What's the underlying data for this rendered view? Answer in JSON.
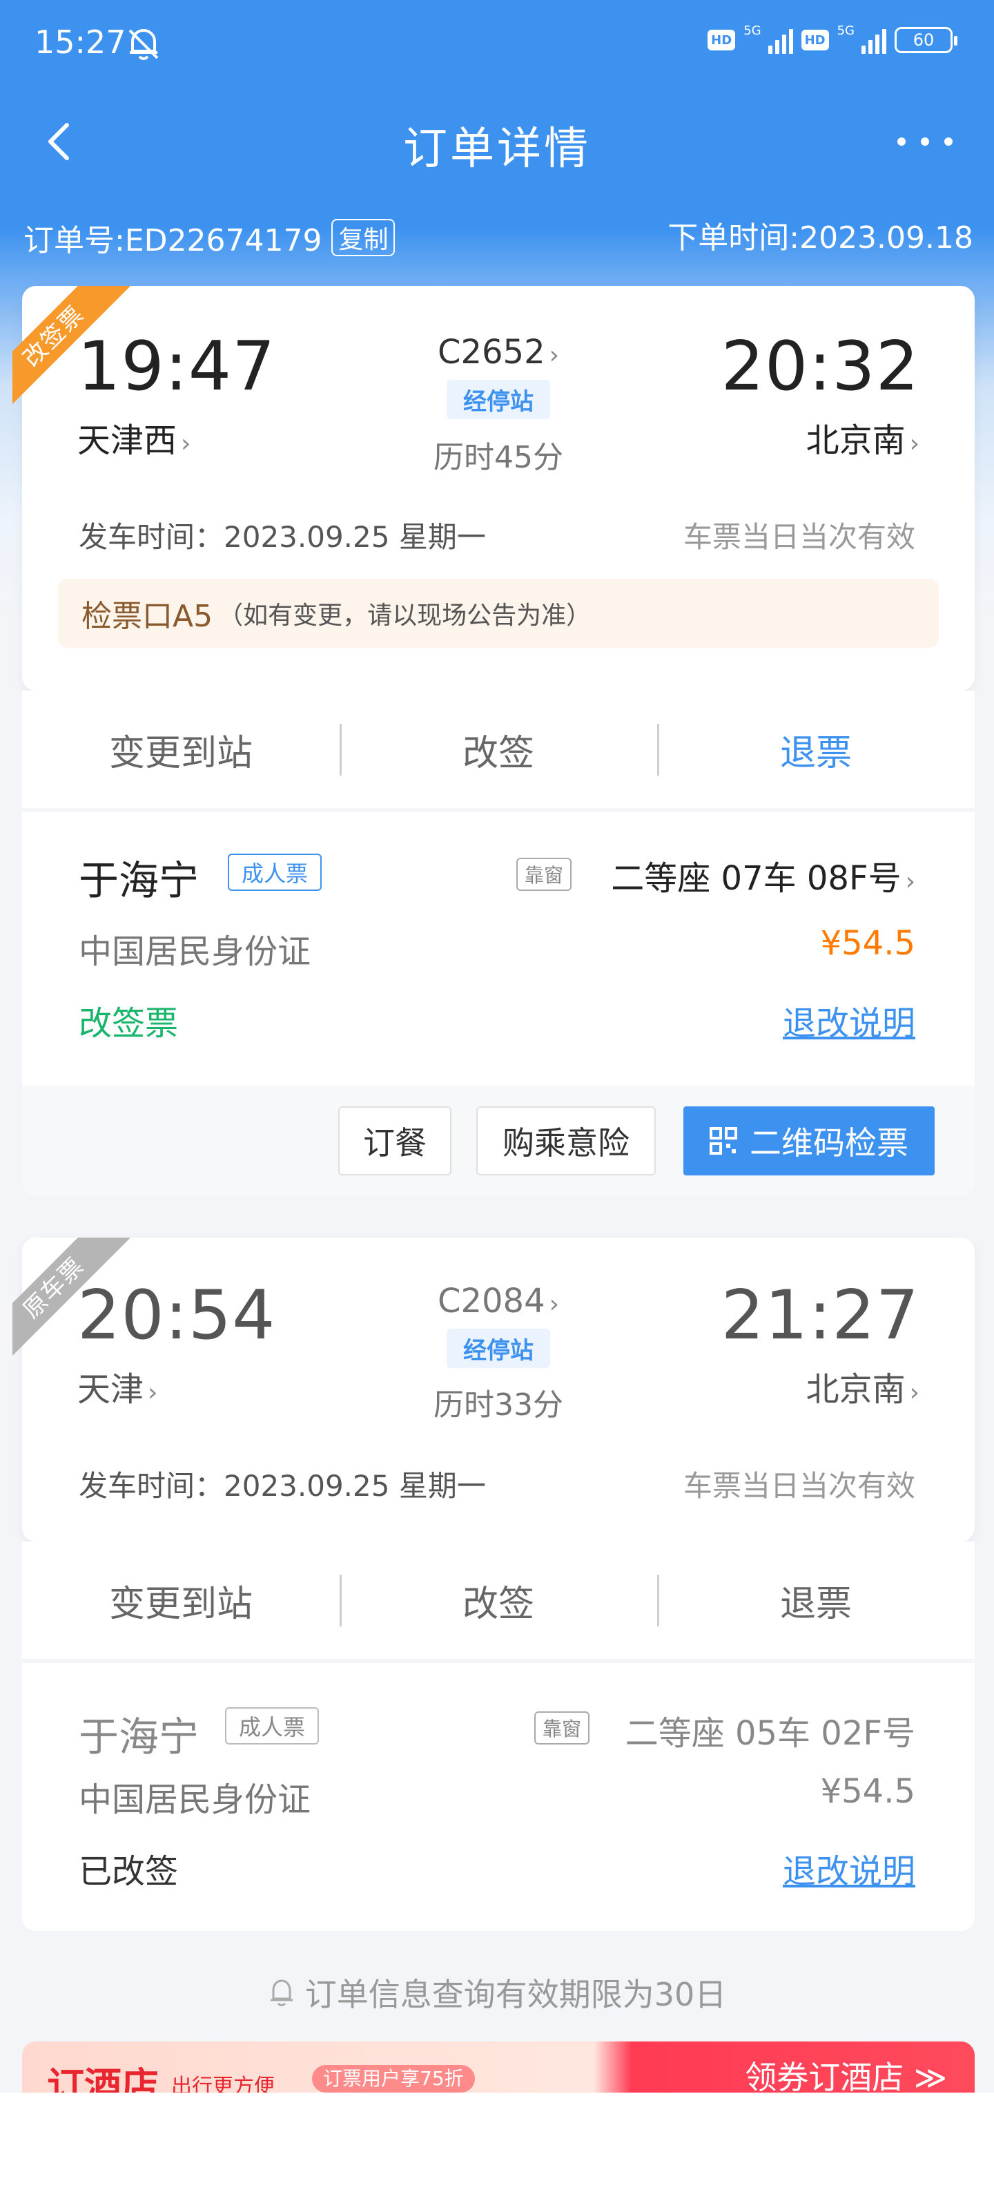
{
  "status_bar": {
    "time": "15:27",
    "network_1": "5G",
    "network_2": "5G",
    "battery": "60"
  },
  "header": {
    "title": "订单详情"
  },
  "order": {
    "number_label": "订单号:ED22674179",
    "copy_label": "复制",
    "time_label": "下单时间:2023.09.18"
  },
  "new_ticket": {
    "ribbon": "改签票",
    "depart_time": "19:47",
    "depart_station": "天津西",
    "train_no": "C2652",
    "via_label": "经停站",
    "duration": "历时45分",
    "arrive_time": "20:32",
    "arrive_station": "北京南",
    "depart_date": "发车时间：2023.09.25 星期一",
    "validity": "车票当日当次有效",
    "gate_main": "检票口A5",
    "gate_note": "（如有变更，请以现场公告为准）",
    "actions": [
      "变更到站",
      "改签",
      "退票"
    ],
    "passenger": {
      "name": "于海宁",
      "type": "成人票",
      "window_tag": "靠窗",
      "seat": "二等座 07车 08F号",
      "id_type": "中国居民身份证",
      "price": "¥54.5",
      "status": "改签票",
      "rules_link": "退改说明"
    },
    "buttons": {
      "meal": "订餐",
      "insurance": "购乘意险",
      "qr": "二维码检票"
    }
  },
  "old_ticket": {
    "ribbon": "原车票",
    "depart_time": "20:54",
    "depart_station": "天津",
    "train_no": "C2084",
    "via_label": "经停站",
    "duration": "历时33分",
    "arrive_time": "21:27",
    "arrive_station": "北京南",
    "depart_date": "发车时间：2023.09.25 星期一",
    "validity": "车票当日当次有效",
    "actions": [
      "变更到站",
      "改签",
      "退票"
    ],
    "passenger": {
      "name": "于海宁",
      "type": "成人票",
      "window_tag": "靠窗",
      "seat": "二等座 05车 02F号",
      "id_type": "中国居民身份证",
      "price": "¥54.5",
      "status": "已改签",
      "rules_link": "退改说明"
    }
  },
  "notice": "订单信息查询有效期限为30日",
  "banner": {
    "title": "订酒店",
    "subtitle": "出行更方便",
    "tag": "订票用户享75折",
    "cta": "领券订酒店 ≫"
  },
  "colors": {
    "primary": "#3d92f0",
    "orange": "#ff7a00",
    "green": "#19b56b",
    "ribbon_new": "#f79a2b",
    "ribbon_old": "#b5b5b5"
  }
}
